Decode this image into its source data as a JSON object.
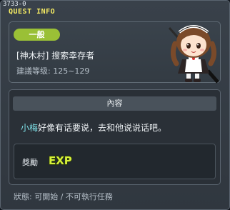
{
  "window": {
    "id_text": "3733-0",
    "title": "QUEST INFO"
  },
  "quest": {
    "level_badge": "一般",
    "name": "[神木村] 搜索幸存者",
    "recommended_level": "建議等级: 125~129"
  },
  "content": {
    "header": "內容",
    "npc_name": "小梅",
    "description_rest": "好像有话要说，去和他说说话吧。"
  },
  "reward": {
    "label": "獎勵",
    "icon": "exp-icon",
    "icon_text": "EXP"
  },
  "status": {
    "text": "狀態: 可開始 / 不可執行任務"
  },
  "colors": {
    "title": "#f6ec63",
    "badge": "#9ac036",
    "npc": "#7ee0e7",
    "exp_fill": "#d7f13a"
  }
}
